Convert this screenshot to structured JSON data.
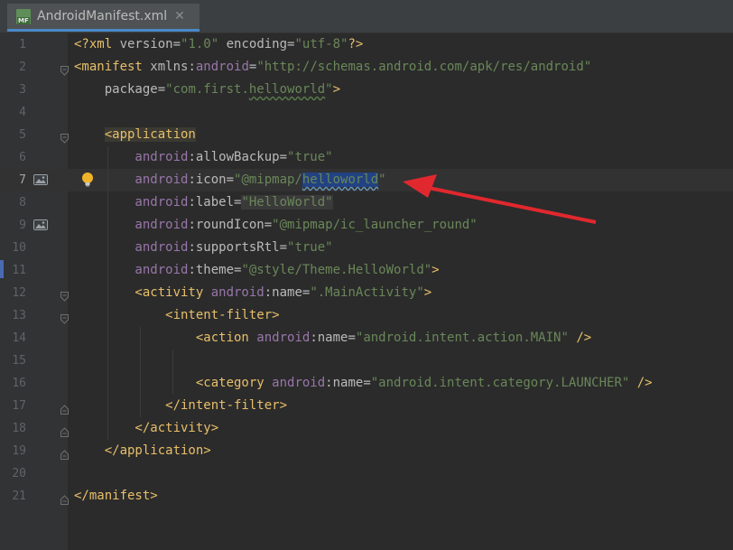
{
  "tab": {
    "icon_text": "MF",
    "title": "AndroidManifest.xml",
    "close": "✕"
  },
  "lines": [
    {
      "n": "1",
      "parts": [
        [
          "pi",
          "<?xml "
        ],
        [
          "a",
          "version="
        ],
        [
          "v",
          "\"1.0\""
        ],
        [
          "a",
          " encoding="
        ],
        [
          "v",
          "\"utf-8\""
        ],
        [
          "pi",
          "?>"
        ]
      ]
    },
    {
      "n": "2",
      "parts": [
        [
          "t",
          "<manifest "
        ],
        [
          "a",
          "xmlns:"
        ],
        [
          "ns",
          "android"
        ],
        [
          "a",
          "="
        ],
        [
          "v",
          "\"http://schemas.android.com/apk/res/android\""
        ]
      ]
    },
    {
      "n": "3",
      "parts": [
        [
          "a",
          "    package="
        ],
        [
          "v",
          "\"com.first."
        ],
        [
          "v",
          "helloworld"
        ],
        [
          "v",
          "\""
        ],
        [
          "t",
          ">"
        ]
      ]
    },
    {
      "n": "4",
      "parts": []
    },
    {
      "n": "5",
      "parts": [
        [
          "t",
          "    <application"
        ]
      ]
    },
    {
      "n": "6",
      "parts": [
        [
          "ns",
          "        android"
        ],
        [
          "a",
          ":allowBackup="
        ],
        [
          "v",
          "\"true\""
        ]
      ]
    },
    {
      "n": "7",
      "parts": [
        [
          "ns",
          "        android"
        ],
        [
          "a",
          ":icon="
        ],
        [
          "v",
          "\"@mipmap/"
        ],
        [
          "v",
          "helloworld"
        ],
        [
          "v",
          "\""
        ]
      ]
    },
    {
      "n": "8",
      "parts": [
        [
          "ns",
          "        android"
        ],
        [
          "a",
          ":label="
        ],
        [
          "v",
          "\"HelloWorld\""
        ]
      ]
    },
    {
      "n": "9",
      "parts": [
        [
          "ns",
          "        android"
        ],
        [
          "a",
          ":roundIcon="
        ],
        [
          "v",
          "\"@mipmap/ic_launcher_round\""
        ]
      ]
    },
    {
      "n": "10",
      "parts": [
        [
          "ns",
          "        android"
        ],
        [
          "a",
          ":supportsRtl="
        ],
        [
          "v",
          "\"true\""
        ]
      ]
    },
    {
      "n": "11",
      "parts": [
        [
          "ns",
          "        android"
        ],
        [
          "a",
          ":theme="
        ],
        [
          "v",
          "\"@style/Theme.HelloWorld\""
        ],
        [
          "t",
          ">"
        ]
      ]
    },
    {
      "n": "12",
      "parts": [
        [
          "t",
          "        <activity "
        ],
        [
          "ns",
          "android"
        ],
        [
          "a",
          ":name="
        ],
        [
          "v",
          "\".MainActivity\""
        ],
        [
          "t",
          ">"
        ]
      ]
    },
    {
      "n": "13",
      "parts": [
        [
          "t",
          "            <intent-filter>"
        ]
      ]
    },
    {
      "n": "14",
      "parts": [
        [
          "t",
          "                <action "
        ],
        [
          "ns",
          "android"
        ],
        [
          "a",
          ":name="
        ],
        [
          "v",
          "\"android.intent.action.MAIN\""
        ],
        [
          "t",
          " />"
        ]
      ]
    },
    {
      "n": "15",
      "parts": []
    },
    {
      "n": "16",
      "parts": [
        [
          "t",
          "                <category "
        ],
        [
          "ns",
          "android"
        ],
        [
          "a",
          ":name="
        ],
        [
          "v",
          "\"android.intent.category.LAUNCHER\""
        ],
        [
          "t",
          " />"
        ]
      ]
    },
    {
      "n": "17",
      "parts": [
        [
          "t",
          "            </intent-filter>"
        ]
      ]
    },
    {
      "n": "18",
      "parts": [
        [
          "t",
          "        </activity>"
        ]
      ]
    },
    {
      "n": "19",
      "parts": [
        [
          "t",
          "    </application>"
        ]
      ]
    },
    {
      "n": "20",
      "parts": []
    },
    {
      "n": "21",
      "parts": [
        [
          "t",
          "</manifest>"
        ]
      ]
    }
  ],
  "current_line": "7",
  "colors": {
    "tag": "#e8bf6a",
    "namespace": "#9876aa",
    "value": "#6a8759",
    "attr": "#bababa",
    "selection": "#214283",
    "arrow": "#e0282e"
  }
}
